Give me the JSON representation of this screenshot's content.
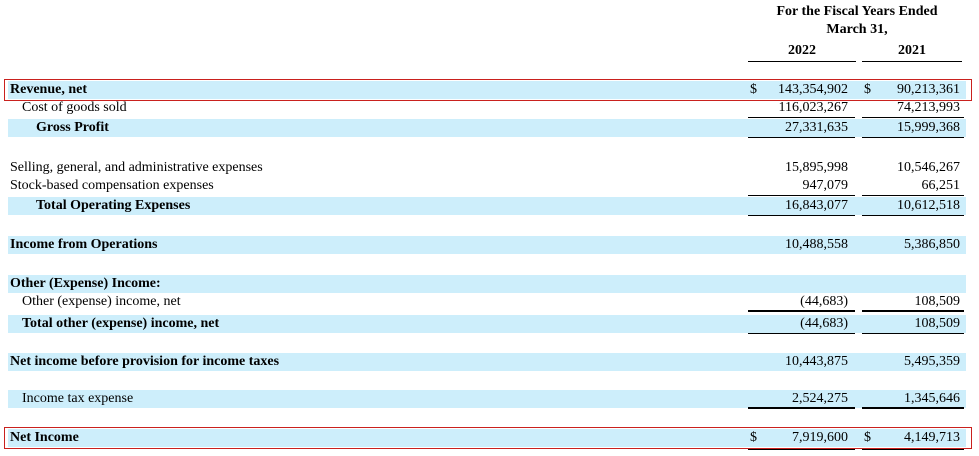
{
  "header": {
    "title_line1": "For the Fiscal Years Ended",
    "title_line2": "March 31,",
    "year_a": "2022",
    "year_b": "2021"
  },
  "rows": [
    {
      "label": "Revenue, net",
      "cur_a": "$",
      "a": "143,354,902",
      "cur_b": "$",
      "b": "90,213,361"
    },
    {
      "label": "Cost of goods sold",
      "a": "116,023,267",
      "b": "74,213,993"
    },
    {
      "label": "Gross Profit",
      "a": "27,331,635",
      "b": "15,999,368"
    },
    {
      "label": "Selling, general, and administrative expenses",
      "a": "15,895,998",
      "b": "10,546,267"
    },
    {
      "label": "Stock-based compensation expenses",
      "a": "947,079",
      "b": "66,251"
    },
    {
      "label": "Total Operating Expenses",
      "a": "16,843,077",
      "b": "10,612,518"
    },
    {
      "label": "Income from Operations",
      "a": "10,488,558",
      "b": "5,386,850"
    },
    {
      "label": "Other (Expense) Income:"
    },
    {
      "label": "Other (expense) income, net",
      "a": "(44,683)",
      "b": "108,509"
    },
    {
      "label": "Total other (expense) income, net",
      "a": "(44,683)",
      "b": "108,509"
    },
    {
      "label": "Net income before provision for income taxes",
      "a": "10,443,875",
      "b": "5,495,359"
    },
    {
      "label": "Income tax expense",
      "a": "2,524,275",
      "b": "1,345,646"
    },
    {
      "label": "Net Income",
      "cur_a": "$",
      "a": "7,919,600",
      "cur_b": "$",
      "b": "4,149,713"
    }
  ]
}
